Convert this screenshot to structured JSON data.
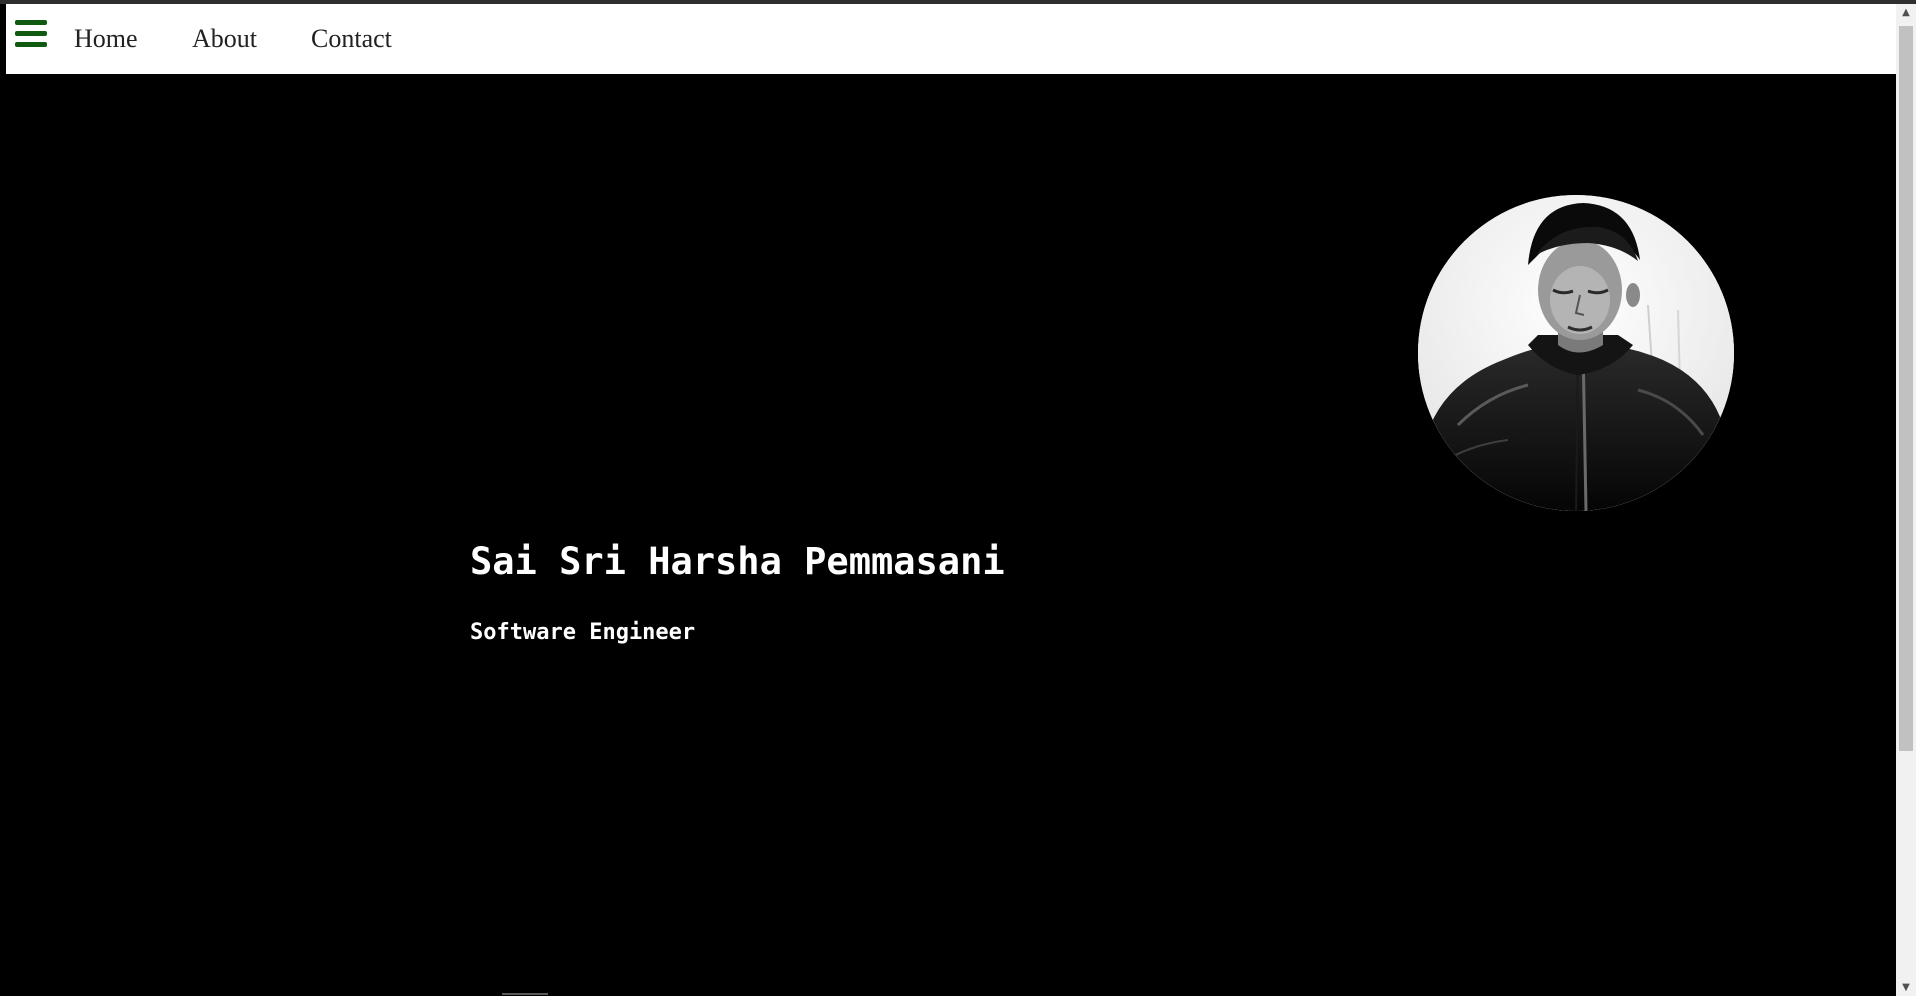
{
  "navbar": {
    "menu_icon": "hamburger-menu-icon",
    "links": [
      {
        "label": "Home"
      },
      {
        "label": "About"
      },
      {
        "label": "Contact"
      }
    ]
  },
  "hero": {
    "name": "Sai Sri Harsha Pemmasani",
    "title": "Software Engineer",
    "avatar": "profile-photo"
  },
  "colors": {
    "menu_icon": "#0f5a0f",
    "navbar_background": "#ffffff",
    "page_background": "#000000",
    "hero_text": "#ffffff"
  },
  "scrollbar": {
    "up_icon": "scroll-up-arrow-icon",
    "down_icon": "scroll-down-arrow-icon"
  }
}
